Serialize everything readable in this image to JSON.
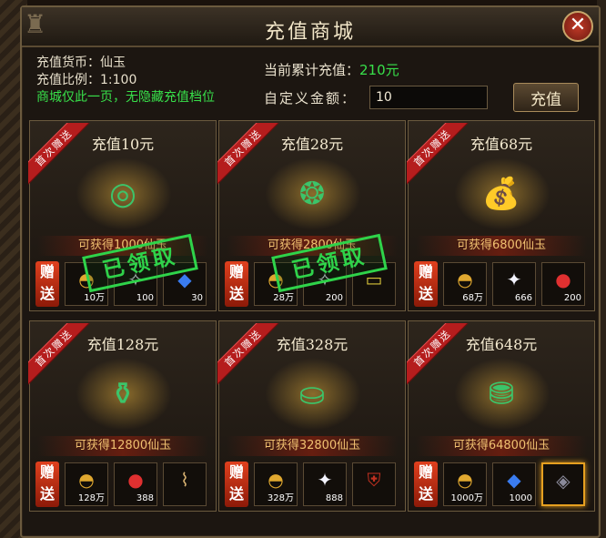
{
  "window": {
    "title": "充值商城"
  },
  "info": {
    "currency": "充值货币：仙玉",
    "ratio": "充值比例：1:100",
    "notice": "商城仅此一页，无隐藏充值档位",
    "total_label": "当前累计充值：",
    "total_value": "210元",
    "custom_label": "自定义金额：",
    "custom_value": "10",
    "recharge_button": "充值"
  },
  "cards": [
    {
      "ribbon": "首次赠送",
      "title": "充值10元",
      "gain": "可获得1000仙玉",
      "gift": "赠送",
      "claimed": true,
      "stamp": "已领取",
      "items": [
        {
          "icon": "gold-ingot-icon",
          "qty": "10万"
        },
        {
          "icon": "silver-icon",
          "qty": "100"
        },
        {
          "icon": "blue-gem-icon",
          "qty": "30"
        }
      ]
    },
    {
      "ribbon": "首次赠送",
      "title": "充值28元",
      "gain": "可获得2800仙玉",
      "gift": "赠送",
      "claimed": true,
      "stamp": "已领取",
      "items": [
        {
          "icon": "gold-ingot-icon",
          "qty": "28万"
        },
        {
          "icon": "silver-icon",
          "qty": "200"
        },
        {
          "icon": "card-icon",
          "qty": ""
        }
      ]
    },
    {
      "ribbon": "首次赠送",
      "title": "充值68元",
      "gain": "可获得6800仙玉",
      "gift": "赠送",
      "claimed": false,
      "stamp": "",
      "items": [
        {
          "icon": "gold-ingot-icon",
          "qty": "68万"
        },
        {
          "icon": "diamond-icon",
          "qty": "666"
        },
        {
          "icon": "red-orb-icon",
          "qty": "200"
        }
      ]
    },
    {
      "ribbon": "首次赠送",
      "title": "充值128元",
      "gain": "可获得12800仙玉",
      "gift": "赠送",
      "claimed": false,
      "stamp": "",
      "items": [
        {
          "icon": "gold-ingot-icon",
          "qty": "128万"
        },
        {
          "icon": "red-orb-icon",
          "qty": "388"
        },
        {
          "icon": "scroll-icon",
          "qty": ""
        }
      ]
    },
    {
      "ribbon": "首次赠送",
      "title": "充值328元",
      "gain": "可获得32800仙玉",
      "gift": "赠送",
      "claimed": false,
      "stamp": "",
      "items": [
        {
          "icon": "gold-ingot-icon",
          "qty": "328万"
        },
        {
          "icon": "diamond-icon",
          "qty": "888"
        },
        {
          "icon": "armor-icon",
          "qty": ""
        }
      ]
    },
    {
      "ribbon": "首次赠送",
      "title": "充值648元",
      "gain": "可获得64800仙玉",
      "gift": "赠送",
      "claimed": false,
      "stamp": "",
      "items": [
        {
          "icon": "gold-ingot-icon",
          "qty": "1000万"
        },
        {
          "icon": "blue-gem-icon",
          "qty": "1000"
        },
        {
          "icon": "rune-icon",
          "qty": ""
        }
      ]
    }
  ],
  "colors": {
    "accent_green": "#38e04a",
    "gain_gold": "#f0c070",
    "ribbon_red": "#b51d1d"
  }
}
